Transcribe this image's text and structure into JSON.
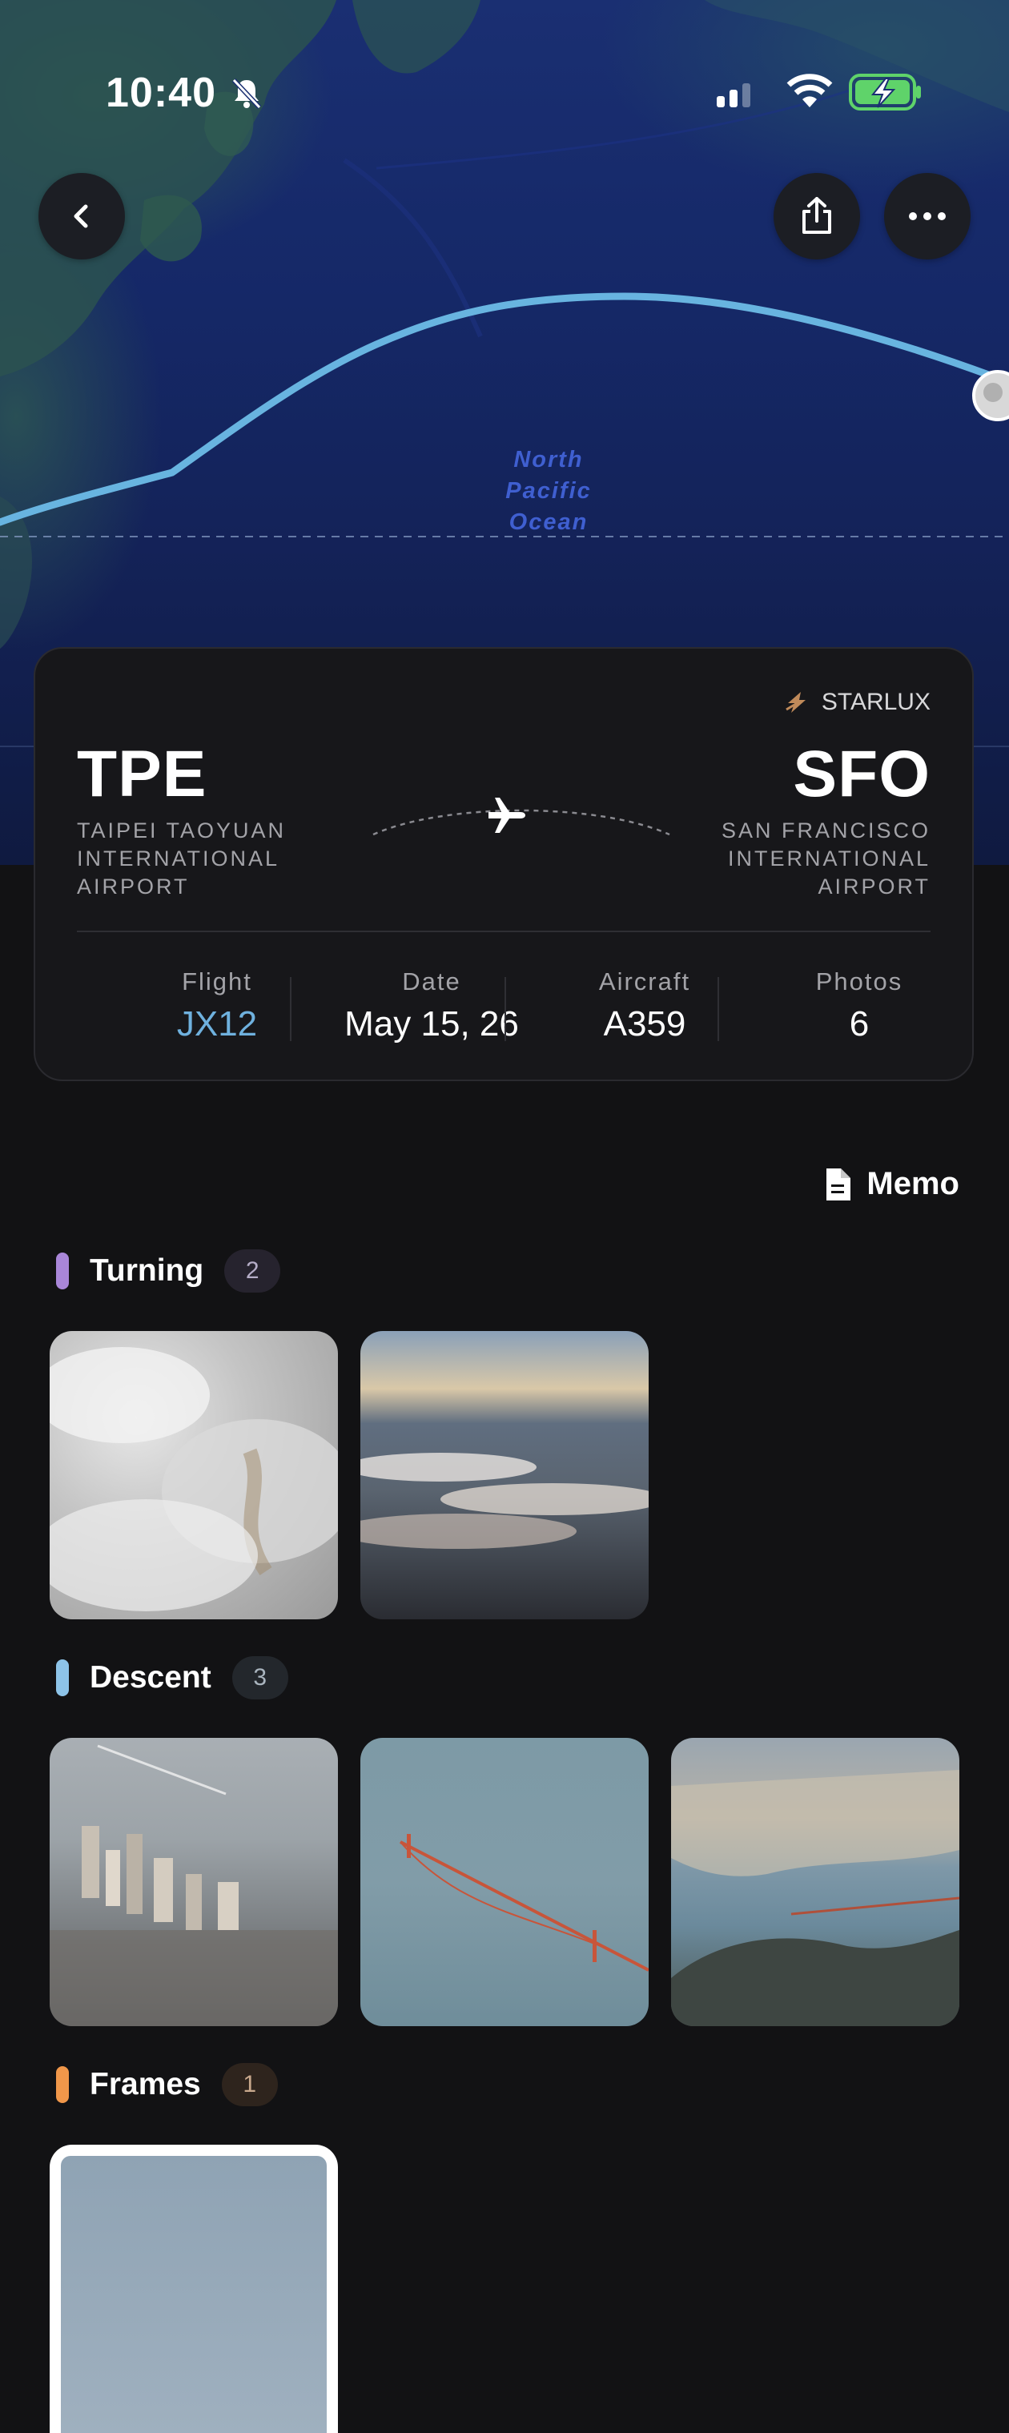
{
  "status_bar": {
    "time": "10:40"
  },
  "map": {
    "ocean_label_lines": [
      "North",
      "Pacific",
      "Ocean"
    ],
    "route_color": "#68b4e0"
  },
  "nav": {
    "back_icon": "chevron-left-icon",
    "share_icon": "share-icon",
    "more_icon": "ellipsis-icon"
  },
  "flight_card": {
    "airline": "STARLUX",
    "origin": {
      "code": "TPE",
      "name_lines": [
        "TAIPEI TAOYUAN",
        "INTERNATIONAL",
        "AIRPORT"
      ]
    },
    "destination": {
      "code": "SFO",
      "name_lines": [
        "SAN FRANCISCO",
        "INTERNATIONAL",
        "AIRPORT"
      ]
    },
    "stats": [
      {
        "label": "Flight",
        "value": "JX12",
        "color": "#6fb1de"
      },
      {
        "label": "Date",
        "value": "May 15, 26"
      },
      {
        "label": "Aircraft",
        "value": "A359"
      },
      {
        "label": "Photos",
        "value": "6"
      }
    ]
  },
  "memo": {
    "label": "Memo",
    "icon": "document-icon"
  },
  "sections": [
    {
      "title": "Turning",
      "count": "2",
      "accent": "#a986d8"
    },
    {
      "title": "Descent",
      "count": "3",
      "accent": "#8dc3e8"
    },
    {
      "title": "Frames",
      "count": "1",
      "accent": "#f0974a"
    }
  ]
}
